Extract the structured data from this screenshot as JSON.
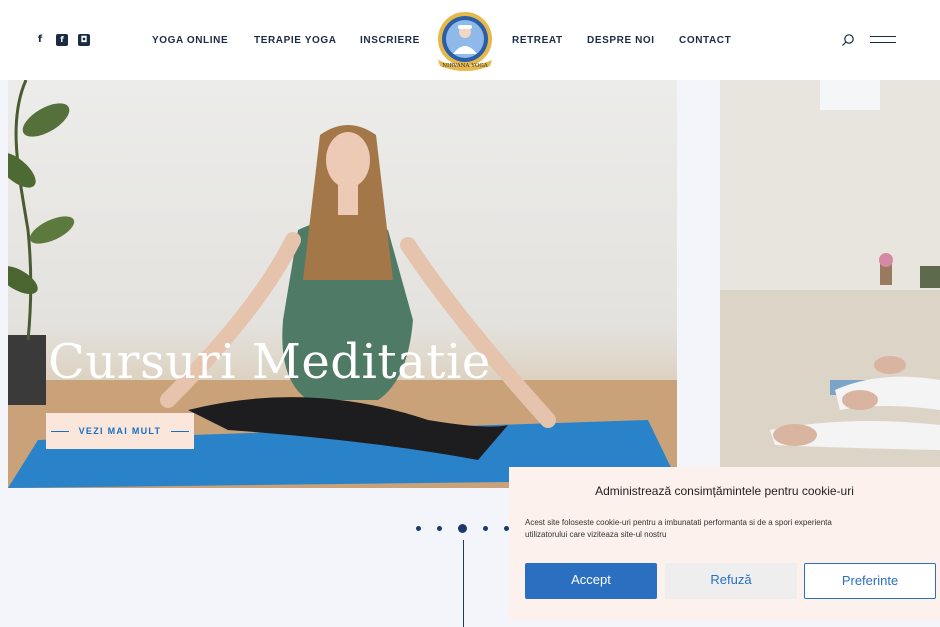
{
  "header": {
    "social_icons": [
      "facebook-icon",
      "facebook-square-icon",
      "instagram-icon"
    ],
    "nav_left": [
      "YOGA ONLINE",
      "TERAPIE YOGA",
      "INSCRIERE"
    ],
    "nav_right": [
      "RETREAT",
      "DESPRE NOI",
      "CONTACT"
    ],
    "logo_text": "NIRVANA YOGA"
  },
  "slider": {
    "title": "Cursuri Meditatie",
    "button_label": "VEZI MAI MULT",
    "dots_count": 5,
    "active_dot": 3
  },
  "cookie": {
    "title": "Administrează consimțămintele pentru cookie-uri",
    "text": "Acest site foloseste cookie-uri pentru a imbunatati performanta si de a spori experienta utilizatorului care viziteaza site-ul nostru",
    "accept": "Accept",
    "refuse": "Refuză",
    "preferences": "Preferinte"
  },
  "colors": {
    "accent": "#2b6fc0",
    "navy": "#1c2b44",
    "peach": "#fbe6dc"
  }
}
